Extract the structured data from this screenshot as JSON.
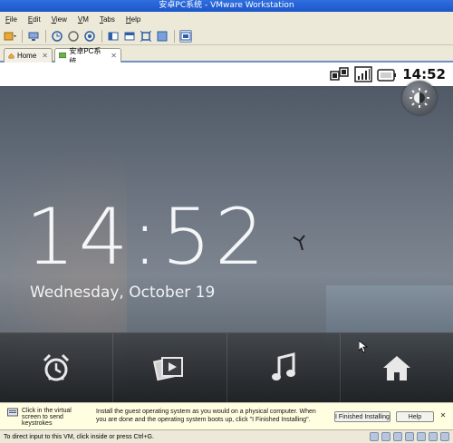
{
  "window": {
    "title": "安卓PC系统 - VMware Workstation"
  },
  "menu": [
    "File",
    "Edit",
    "View",
    "VM",
    "Tabs",
    "Help"
  ],
  "tabs": [
    {
      "label": "Home",
      "active": false
    },
    {
      "label": "安卓PC系统",
      "active": true
    }
  ],
  "android": {
    "status_time": "14:52",
    "clock": "14:52",
    "date": "Wednesday, October 19",
    "dock": [
      "alarm-clock",
      "gallery",
      "music",
      "home"
    ]
  },
  "hint": {
    "left": "Click in the virtual screen to send keystrokes",
    "middle": "Install the guest operating system as you would on a physical computer. When you are done and the operating system boots up, click \"I Finished Installing\".",
    "finished_button": "I Finished Installing",
    "help_button": "Help"
  },
  "status": {
    "text": "To direct input to this VM, click inside or press Ctrl+G."
  },
  "colors": {
    "accent": "#1b56c9",
    "hint_bg": "#fffee1"
  }
}
